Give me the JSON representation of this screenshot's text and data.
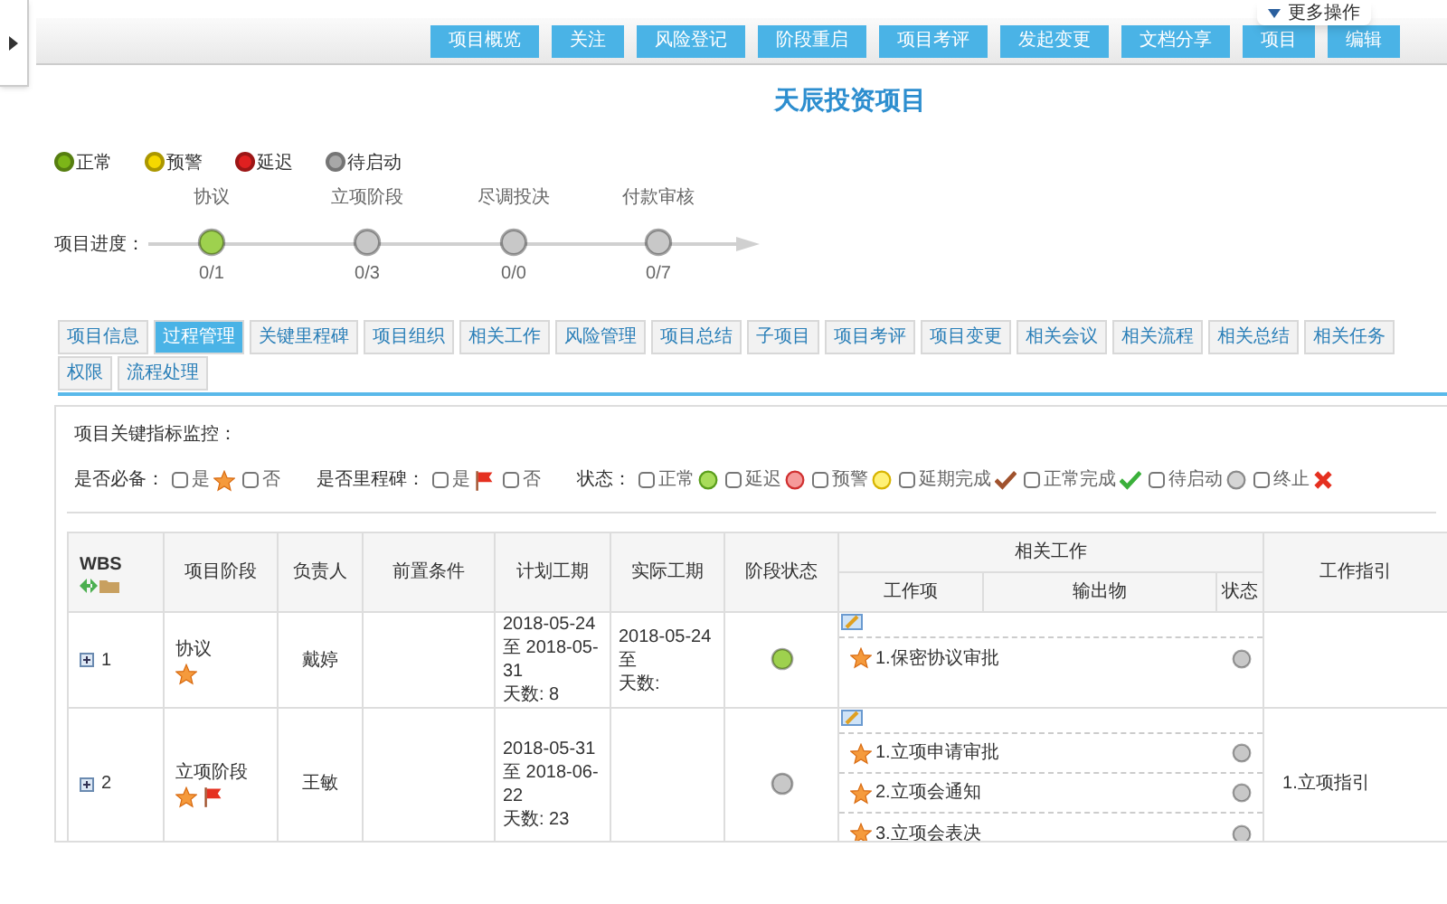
{
  "toolbar": {
    "buttons": [
      "项目概览",
      "关注",
      "风险登记",
      "阶段重启",
      "项目考评",
      "发起变更",
      "文档分享",
      "项目",
      "编辑"
    ],
    "more_menu": "更多操作"
  },
  "title": "天辰投资项目",
  "legend": [
    {
      "label": "正常",
      "color": "#7cb518"
    },
    {
      "label": "预警",
      "color": "#f5d800"
    },
    {
      "label": "延迟",
      "color": "#e02020"
    },
    {
      "label": "待启动",
      "color": "#a8a8a8"
    }
  ],
  "progress": {
    "label": "项目进度：",
    "stages": [
      {
        "name": "协议",
        "count": "0/1",
        "color": "#9ed14e"
      },
      {
        "name": "立项阶段",
        "count": "0/3",
        "color": "#c8c8c8"
      },
      {
        "name": "尽调投决",
        "count": "0/0",
        "color": "#c8c8c8"
      },
      {
        "name": "付款审核",
        "count": "0/7",
        "color": "#c8c8c8"
      }
    ]
  },
  "tabs": [
    {
      "label": "项目信息",
      "selected": false
    },
    {
      "label": "过程管理",
      "selected": true
    },
    {
      "label": "关键里程碑",
      "selected": false
    },
    {
      "label": "项目组织",
      "selected": false
    },
    {
      "label": "相关工作",
      "selected": false
    },
    {
      "label": "风险管理",
      "selected": false
    },
    {
      "label": "项目总结",
      "selected": false
    },
    {
      "label": "子项目",
      "selected": false
    },
    {
      "label": "项目考评",
      "selected": false
    },
    {
      "label": "项目变更",
      "selected": false
    },
    {
      "label": "相关会议",
      "selected": false
    },
    {
      "label": "相关流程",
      "selected": false
    },
    {
      "label": "相关总结",
      "selected": false
    },
    {
      "label": "相关任务",
      "selected": false
    },
    {
      "label": "权限",
      "selected": false
    },
    {
      "label": "流程处理",
      "selected": false
    }
  ],
  "monitor": {
    "title": "项目关键指标监控：",
    "groups": [
      {
        "label": "是否必备：",
        "options": [
          {
            "label": "是",
            "kind": "star",
            "checked": false
          },
          {
            "label": "否",
            "kind": "plain",
            "checked": false
          }
        ]
      },
      {
        "label": "是否里程碑：",
        "options": [
          {
            "label": "是",
            "kind": "flag",
            "checked": false
          },
          {
            "label": "否",
            "kind": "plain",
            "checked": false
          }
        ]
      },
      {
        "label": "状态：",
        "options": [
          {
            "label": "正常",
            "kind": "normal",
            "checked": false
          },
          {
            "label": "延迟",
            "kind": "delayed",
            "checked": false
          },
          {
            "label": "预警",
            "kind": "warning",
            "checked": false
          },
          {
            "label": "延期完成",
            "kind": "late-done",
            "checked": false
          },
          {
            "label": "正常完成",
            "kind": "done",
            "checked": false
          },
          {
            "label": "待启动",
            "kind": "pending",
            "checked": false
          },
          {
            "label": "终止",
            "kind": "stopped",
            "checked": false
          }
        ]
      }
    ]
  },
  "table": {
    "columns": [
      "WBS",
      "项目阶段",
      "负责人",
      "前置条件",
      "计划工期",
      "实际工期",
      "阶段状态",
      "相关工作",
      "工作指引"
    ],
    "related_work_columns": [
      "工作项",
      "输出物",
      "状态"
    ],
    "rows": [
      {
        "wbs": "1",
        "phase": "协议",
        "required": true,
        "milestone": false,
        "owner": "戴婷",
        "planned": [
          "2018-05-24",
          "至 2018-05-",
          "31",
          "天数: 8"
        ],
        "actual": [
          "2018-05-24",
          "至",
          "天数:"
        ],
        "color": "#9ed14e",
        "work_items": [
          {
            "label": "1.保密协议审批",
            "required": true,
            "color": "#c8c8c8"
          }
        ]
      },
      {
        "wbs": "2",
        "phase": "立项阶段",
        "required": true,
        "milestone": true,
        "owner": "王敏",
        "planned": [
          "2018-05-31",
          "至 2018-06-",
          "22",
          "天数: 23"
        ],
        "color": "#c8c8c8",
        "work_items": [
          {
            "label": "1.立项申请审批",
            "required": true,
            "color": "#c8c8c8"
          },
          {
            "label": "2.立项会通知",
            "required": true,
            "color": "#c8c8c8"
          },
          {
            "label": "3.立项会表决",
            "required": true,
            "color": "#c8c8c8"
          }
        ],
        "guide": "1.立项指引"
      }
    ]
  }
}
